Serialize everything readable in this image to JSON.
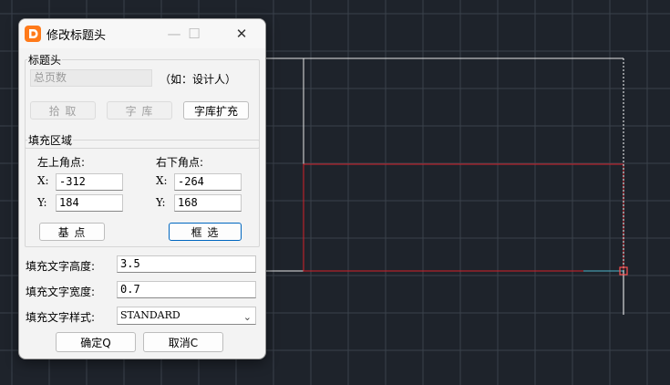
{
  "dialog": {
    "title": "修改标题头",
    "controls": {
      "minimize": "—",
      "maximize": "☐",
      "close": "✕"
    }
  },
  "header_group": {
    "legend": "标题头",
    "input_value": "总页数",
    "hint": "（如：设计人）",
    "pick_label": "拾 取",
    "font_lib_label": "字 库",
    "font_lib_expand_label": "字库扩充"
  },
  "fill_group": {
    "legend": "填充区域",
    "top_left_label": "左上角点:",
    "bottom_right_label": "右下角点:",
    "x_label": "X:",
    "y_label": "Y:",
    "top_left_x": "-312",
    "top_left_y": "184",
    "bottom_right_x": "-264",
    "bottom_right_y": "168",
    "base_point_label": "基 点",
    "box_select_label": "框 选"
  },
  "text_settings": {
    "height_label": "填充文字高度:",
    "height_value": "3.5",
    "width_label": "填充文字宽度:",
    "width_value": "0.7",
    "style_label": "填充文字样式:",
    "style_value": "STANDARD"
  },
  "actions": {
    "ok_label": "确定Q",
    "cancel_label": "取消C"
  },
  "colors": {
    "canvas_bg": "#1e232b",
    "grid": "#3a414b",
    "frame_line": "#e0e0e0",
    "selection_red": "#d4202a",
    "cursor": "#ffffff",
    "accent_blue": "#0067c0"
  }
}
